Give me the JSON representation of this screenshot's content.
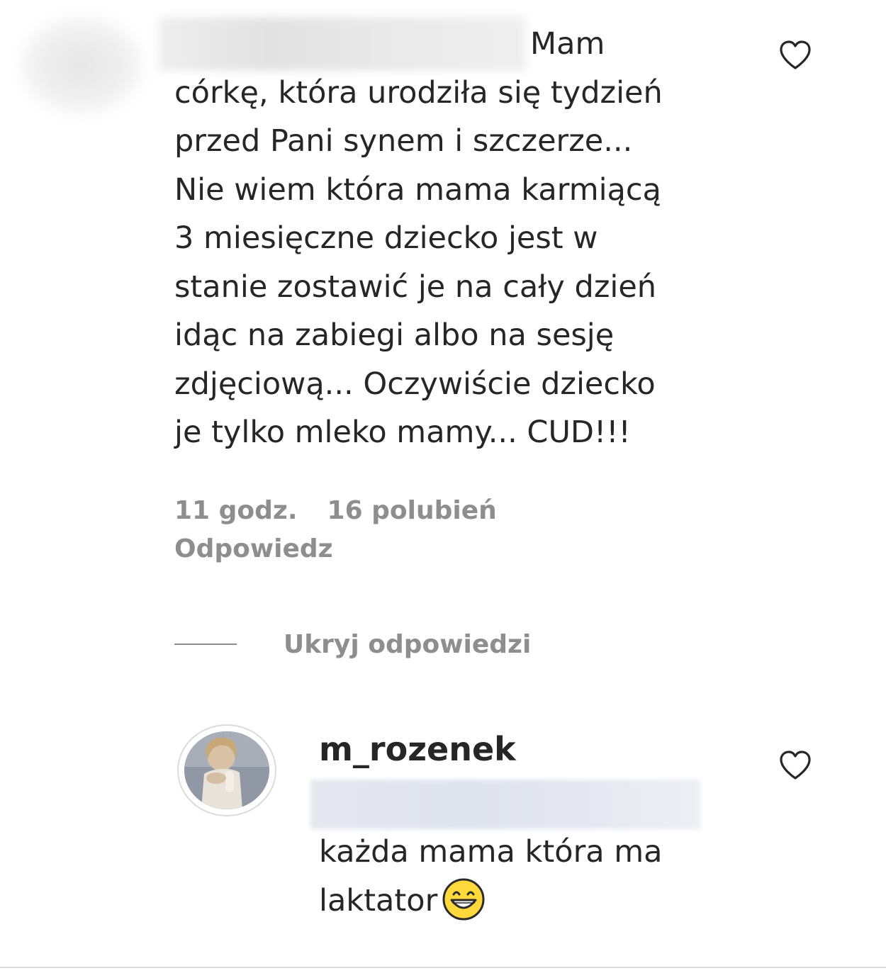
{
  "comment": {
    "text_first": "Mam",
    "text_rest": "córkę, która urodziła się tydzień przed Pani synem i szczerze... Nie wiem która mama karmiącą 3 miesięczne dziecko jest w stanie zostawić je na cały dzień idąc na zabiegi albo na sesję zdjęciową... Oczywiście dziecko je tylko mleko mamy... CUD!!!",
    "lines": [
      "córkę, która urodziła się tydzień",
      "przed Pani synem i szczerze...",
      "Nie wiem która mama karmiącą",
      "3 miesięczne dziecko jest w",
      "stanie zostawić je na cały dzień",
      "idąc na zabiegi albo na sesję",
      "zdjęciową... Oczywiście dziecko",
      "je tylko mleko mamy... CUD!!!"
    ],
    "time": "11 godz.",
    "likes": "16 polubień",
    "reply_label": "Odpowiedz"
  },
  "thread": {
    "hide_replies_label": "Ukryj odpowiedzi"
  },
  "reply": {
    "username": "m_rozenek",
    "text_line1": "każda mama która ma",
    "text_line2": "laktator",
    "emoji": "grinning-face-with-smiling-eyes"
  },
  "icons": {
    "like": "heart-outline-icon"
  },
  "colors": {
    "text": "#262626",
    "secondary": "#8e8e8e",
    "divider": "#dbdbdb"
  }
}
